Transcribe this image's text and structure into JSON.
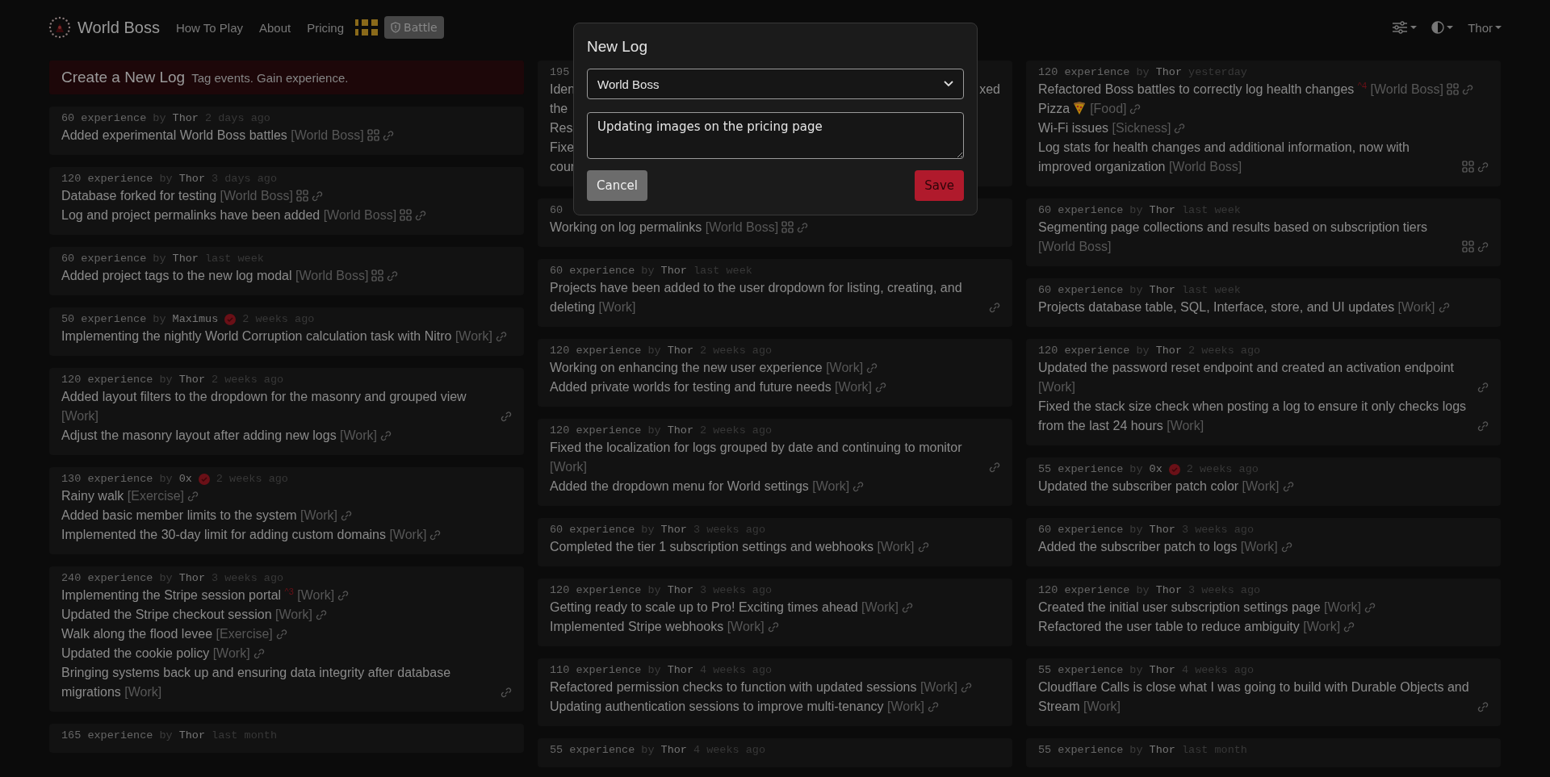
{
  "nav": {
    "brand": "World Boss",
    "links": [
      {
        "label": "How To Play"
      },
      {
        "label": "About"
      },
      {
        "label": "Pricing"
      }
    ],
    "battle_button": "Battle",
    "user": "Thor"
  },
  "banner": {
    "title": "Create a New Log",
    "subtitle": "Tag events. Gain experience."
  },
  "columns": [
    [
      {
        "kind": "log",
        "experience": "60 experience",
        "by": "by",
        "author": "Thor",
        "verified": false,
        "time": "2 days ago",
        "entries": [
          {
            "text": "Added experimental World Boss battles",
            "tag": "[World Boss]",
            "project": true
          }
        ]
      },
      {
        "kind": "log",
        "experience": "120 experience",
        "by": "by",
        "author": "Thor",
        "verified": false,
        "time": "3 days ago",
        "entries": [
          {
            "text": "Database forked for testing",
            "tag": "[World Boss]",
            "project": true
          },
          {
            "text": "Log and project permalinks have been added",
            "tag": "[World Boss]",
            "project": true
          }
        ]
      },
      {
        "kind": "log",
        "experience": "60 experience",
        "by": "by",
        "author": "Thor",
        "verified": false,
        "time": "last week",
        "entries": [
          {
            "text": "Added project tags to the new log modal",
            "tag": "[World Boss]",
            "project": true
          }
        ]
      },
      {
        "kind": "log",
        "experience": "50 experience",
        "by": "by",
        "author": "Maximus",
        "verified": true,
        "time": "2 weeks ago",
        "entries": [
          {
            "text": "Implementing the nightly World Corruption calculation task with Nitro",
            "tag": "[Work]",
            "project": false
          }
        ]
      },
      {
        "kind": "log",
        "experience": "120 experience",
        "by": "by",
        "author": "Thor",
        "verified": false,
        "time": "2 weeks ago",
        "entries": [
          {
            "text": "Added layout filters to the dropdown for the masonry and grouped view",
            "tag": "[Work]",
            "project": false
          },
          {
            "text": "Adjust the masonry layout after adding new logs",
            "tag": "[Work]",
            "project": false
          }
        ]
      },
      {
        "kind": "log",
        "experience": "130 experience",
        "by": "by",
        "author": "0x",
        "verified": true,
        "time": "2 weeks ago",
        "entries": [
          {
            "text": "Rainy walk",
            "tag": "[Exercise]",
            "project": false
          },
          {
            "text": "Added basic member limits to the system",
            "tag": "[Work]",
            "project": false
          },
          {
            "text": "Implemented the 30-day limit for adding custom domains",
            "tag": "[Work]",
            "project": false
          }
        ]
      },
      {
        "kind": "log",
        "experience": "240 experience",
        "by": "by",
        "author": "Thor",
        "verified": false,
        "time": "3 weeks ago",
        "entries": [
          {
            "text": "Implementing the Stripe session portal",
            "stack": "^3",
            "tag": "[Work]",
            "project": false
          },
          {
            "text": "Updated the Stripe checkout session",
            "tag": "[Work]",
            "project": false
          },
          {
            "text": "Walk along the flood levee",
            "tag": "[Exercise]",
            "project": false
          },
          {
            "text": "Updated the cookie policy",
            "tag": "[Work]",
            "project": false
          },
          {
            "text": "Bringing systems back up and ensuring data integrity after database migrations",
            "tag": "[Work]",
            "project": false
          }
        ]
      },
      {
        "kind": "log",
        "experience": "165 experience",
        "by": "by",
        "author": "Thor",
        "verified": false,
        "time": "last month"
      }
    ],
    [
      {
        "kind": "covered",
        "experience": "195",
        "lines": [
          {
            "left": "Iden",
            "right": "xed"
          },
          {
            "left": "the"
          },
          {
            "left": "Res"
          },
          {
            "left": "Fixe"
          },
          {
            "left": "cour"
          }
        ]
      },
      {
        "kind": "log",
        "experience": "60",
        "verified": false,
        "entries": [
          {
            "text": "Working on log permalinks",
            "tag": "[World Boss]",
            "project": true
          }
        ]
      },
      {
        "kind": "log",
        "experience": "60 experience",
        "by": "by",
        "author": "Thor",
        "verified": false,
        "time": "last week",
        "entries": [
          {
            "text": "Projects have been added to the user dropdown for listing, creating, and deleting",
            "tag": "[Work]",
            "project": false
          }
        ]
      },
      {
        "kind": "log",
        "experience": "120 experience",
        "by": "by",
        "author": "Thor",
        "verified": false,
        "time": "2 weeks ago",
        "entries": [
          {
            "text": "Working on enhancing the new user experience",
            "tag": "[Work]",
            "project": false
          },
          {
            "text": "Added private worlds for testing and future needs",
            "tag": "[Work]",
            "project": false
          }
        ]
      },
      {
        "kind": "log",
        "experience": "120 experience",
        "by": "by",
        "author": "Thor",
        "verified": false,
        "time": "2 weeks ago",
        "entries": [
          {
            "text": "Fixed the localization for logs grouped by date and continuing to monitor",
            "tag": "[Work]",
            "project": false
          },
          {
            "text": "Added the dropdown menu for World settings",
            "tag": "[Work]",
            "project": false
          }
        ]
      },
      {
        "kind": "log",
        "experience": "60 experience",
        "by": "by",
        "author": "Thor",
        "verified": false,
        "time": "3 weeks ago",
        "entries": [
          {
            "text": "Completed the tier 1 subscription settings and webhooks",
            "tag": "[Work]",
            "project": false
          }
        ]
      },
      {
        "kind": "log",
        "experience": "120 experience",
        "by": "by",
        "author": "Thor",
        "verified": false,
        "time": "3 weeks ago",
        "entries": [
          {
            "text": "Getting ready to scale up to Pro! Exciting times ahead",
            "tag": "[Work]",
            "project": false
          },
          {
            "text": "Implemented Stripe webhooks",
            "tag": "[Work]",
            "project": false
          }
        ]
      },
      {
        "kind": "log",
        "experience": "110 experience",
        "by": "by",
        "author": "Thor",
        "verified": false,
        "time": "4 weeks ago",
        "entries": [
          {
            "text": "Refactored permission checks to function with updated sessions",
            "tag": "[Work]",
            "project": false
          },
          {
            "text": "Updating authentication sessions to improve multi-tenancy",
            "tag": "[Work]",
            "project": false
          }
        ]
      },
      {
        "kind": "log",
        "experience": "55 experience",
        "by": "by",
        "author": "Thor",
        "verified": false,
        "time": "4 weeks ago"
      }
    ],
    [
      {
        "kind": "log",
        "experience": "120 experience",
        "by": "by",
        "author": "Thor",
        "verified": false,
        "time": "yesterday",
        "entries": [
          {
            "kind": "plain",
            "text": "Refactored Boss battles to correctly log health changes",
            "stack": "^4",
            "tag": "[World Boss]",
            "project": true
          },
          {
            "kind": "emoji",
            "text": "Pizza",
            "tag": "[Food]",
            "project": false
          },
          {
            "kind": "plain",
            "text": "Wi-Fi issues",
            "tag": "[Sickness]",
            "project": false
          },
          {
            "kind": "plain",
            "text": "Log stats for health changes and additional information, now with improved organization",
            "tag": "[World Boss]",
            "project": true
          }
        ]
      },
      {
        "kind": "log",
        "experience": "60 experience",
        "by": "by",
        "author": "Thor",
        "verified": false,
        "time": "last week",
        "entries": [
          {
            "text": "Segmenting page collections and results based on subscription tiers",
            "tag": "[World Boss]",
            "project": true
          }
        ]
      },
      {
        "kind": "log",
        "experience": "60 experience",
        "by": "by",
        "author": "Thor",
        "verified": false,
        "time": "last week",
        "entries": [
          {
            "text": "Projects database table, SQL, Interface, store, and UI updates",
            "tag": "[Work]",
            "project": false
          }
        ]
      },
      {
        "kind": "log",
        "experience": "120 experience",
        "by": "by",
        "author": "Thor",
        "verified": false,
        "time": "2 weeks ago",
        "entries": [
          {
            "text": "Updated the password reset endpoint and created an activation endpoint",
            "tag": "[Work]",
            "project": false
          },
          {
            "text": "Fixed the stack size check when posting a log to ensure it only checks logs from the last 24 hours",
            "tag": "[Work]",
            "project": false
          }
        ]
      },
      {
        "kind": "log",
        "experience": "55 experience",
        "by": "by",
        "author": "0x",
        "verified": true,
        "time": "2 weeks ago",
        "entries": [
          {
            "text": "Updated the subscriber patch color",
            "tag": "[Work]",
            "project": false
          }
        ]
      },
      {
        "kind": "log",
        "experience": "60 experience",
        "by": "by",
        "author": "Thor",
        "verified": false,
        "time": "3 weeks ago",
        "entries": [
          {
            "text": "Added the subscriber patch to logs",
            "tag": "[Work]",
            "project": false
          }
        ]
      },
      {
        "kind": "log",
        "experience": "120 experience",
        "by": "by",
        "author": "Thor",
        "verified": false,
        "time": "3 weeks ago",
        "entries": [
          {
            "text": "Created the initial user subscription settings page",
            "tag": "[Work]",
            "project": false
          },
          {
            "text": "Refactored the user table to reduce ambiguity",
            "tag": "[Work]",
            "project": false
          }
        ]
      },
      {
        "kind": "log",
        "experience": "55 experience",
        "by": "by",
        "author": "Thor",
        "verified": false,
        "time": "4 weeks ago",
        "entries": [
          {
            "text": "Cloudflare Calls is close what I was going to build with Durable Objects and Stream",
            "tag": "[Work]",
            "project": false
          }
        ]
      },
      {
        "kind": "log",
        "experience": "55 experience",
        "by": "by",
        "author": "Thor",
        "verified": false,
        "time": "last month"
      }
    ]
  ],
  "modal": {
    "title": "New Log",
    "project": "World Boss",
    "note": "Updating images on the pricing page",
    "buttons": [
      {
        "label": "Cancel",
        "kind": "cancel"
      },
      {
        "label": "Save",
        "kind": "save"
      }
    ]
  }
}
